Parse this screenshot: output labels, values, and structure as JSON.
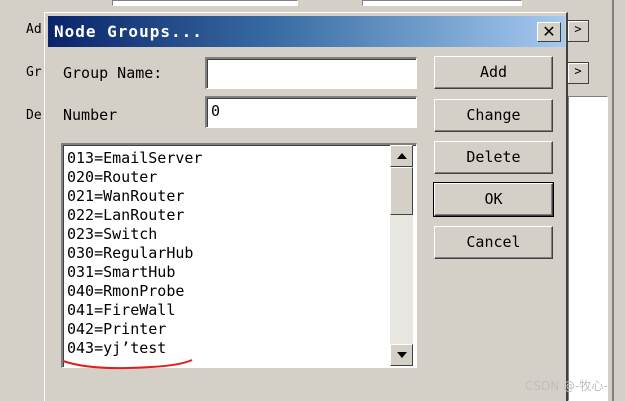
{
  "background": {
    "labels": [
      "Ad",
      "Gr",
      "De"
    ]
  },
  "dialog": {
    "title": "Node Groups...",
    "close_glyph": "✕",
    "group_name_label": "Group Name:",
    "group_name_value": "",
    "number_label": "Number",
    "number_value": "0",
    "buttons": {
      "add": "Add",
      "change": "Change",
      "delete": "Delete",
      "ok": "OK",
      "cancel": "Cancel"
    },
    "list_items": [
      "013=EmailServer",
      "020=Router",
      "021=WanRouter",
      "022=LanRouter",
      "023=Switch",
      "030=RegularHub",
      "031=SmartHub",
      "040=RmonProbe",
      "041=FireWall",
      "042=Printer",
      "043=yj’test"
    ],
    "scroll_up_icon": "triangle-up",
    "scroll_down_icon": "triangle-down"
  },
  "watermark": "CSDN @-牧心-",
  "colors": {
    "title_start": "#0a246a",
    "title_end": "#a6caf0",
    "face": "#d4d0c8",
    "annotation": "#e02020"
  }
}
